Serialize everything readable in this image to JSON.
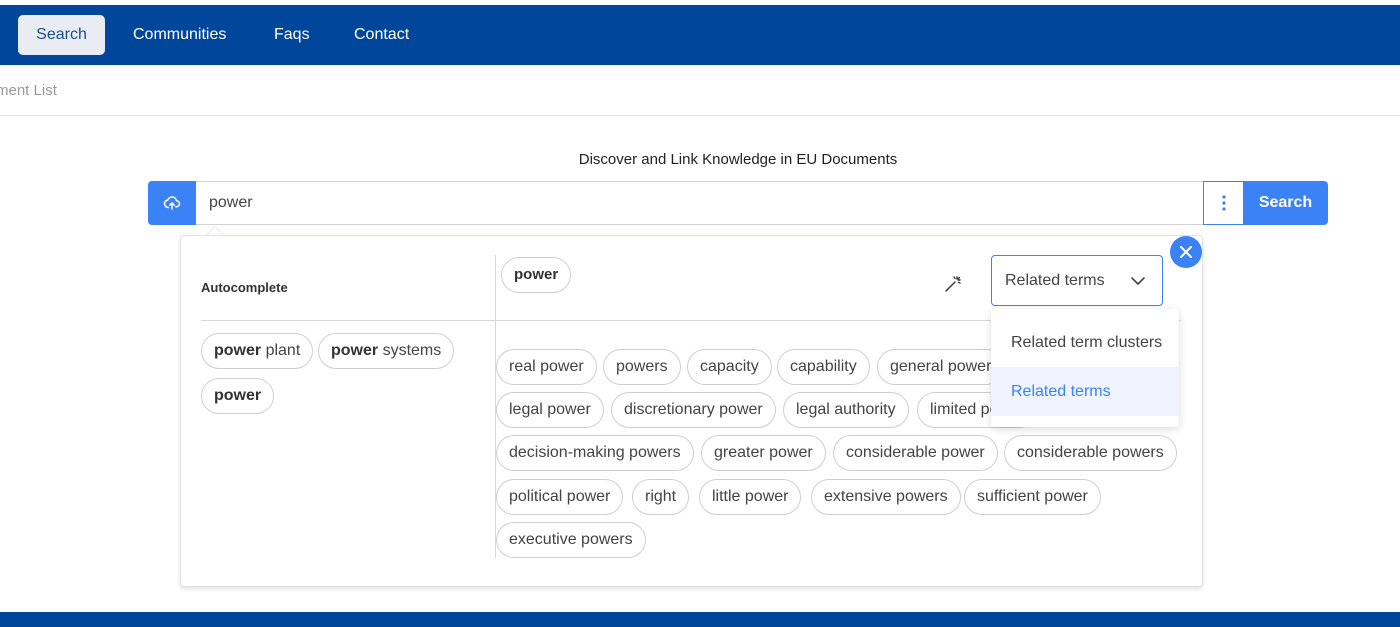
{
  "nav": {
    "items": [
      {
        "label": "Search",
        "active": true
      },
      {
        "label": "Communities",
        "active": false
      },
      {
        "label": "Faqs",
        "active": false
      },
      {
        "label": "Contact",
        "active": false
      }
    ]
  },
  "breadcrumb": "ment List",
  "page_title": "Discover and Link Knowledge in EU Documents",
  "search": {
    "value": "power",
    "button_label": "Search"
  },
  "autocomplete": {
    "heading": "Autocomplete",
    "suggestions": [
      {
        "bold": "power",
        "rest": " plant"
      },
      {
        "bold": "power",
        "rest": " systems"
      },
      {
        "bold": "power",
        "rest": ""
      }
    ]
  },
  "selected_term": "power",
  "term_select": {
    "value": "Related terms",
    "options": [
      "Related term clusters",
      "Related terms"
    ],
    "active_option": "Related terms"
  },
  "related_terms": [
    "real power",
    "powers",
    "capacity",
    "capability",
    "general power",
    "legal power",
    "discretionary power",
    "legal authority",
    "limited power",
    "decision-making powers",
    "greater power",
    "considerable power",
    "considerable powers",
    "political power",
    "right",
    "little power",
    "extensive powers",
    "sufficient power",
    "executive powers"
  ],
  "colors": {
    "navbar": "#00469a",
    "accent": "#3b82f6",
    "active_option_bg": "#eef3fd"
  },
  "icons": {
    "upload": "cloud-upload-icon",
    "more": "kebab-icon",
    "close": "close-icon",
    "wand": "magic-wand-icon",
    "chevron": "chevron-down-icon"
  }
}
